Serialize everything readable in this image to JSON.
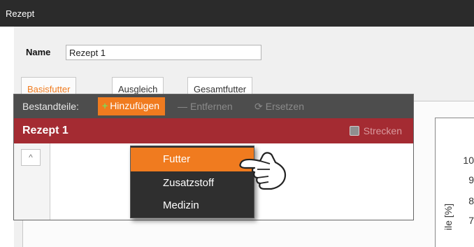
{
  "window": {
    "title": "Rezept"
  },
  "form": {
    "name_label": "Name",
    "name_value": "Rezept 1"
  },
  "tabs": [
    {
      "label": "Basisfutter",
      "active": true
    },
    {
      "label": "Ausgleich",
      "active": false
    },
    {
      "label": "Gesamtfutter",
      "active": false
    }
  ],
  "toolbar": {
    "label": "Bestandteile:",
    "add_icon": "+",
    "add_label": "Hinzufügen",
    "remove_icon": "—",
    "remove_label": "Entfernen",
    "replace_icon": "⟳",
    "replace_label": "Ersetzen"
  },
  "recipe": {
    "name": "Rezept 1",
    "stretch_label": "Strecken"
  },
  "dropdown": {
    "items": [
      {
        "label": "Futter",
        "active": true
      },
      {
        "label": "Zusatzstoff",
        "active": false
      },
      {
        "label": "Medizin",
        "active": false
      }
    ]
  },
  "chart": {
    "y_axis_label": "ile [%]",
    "ticks": [
      "10",
      "9",
      "8",
      "7"
    ]
  },
  "colors": {
    "accent": "#f07b1f",
    "titlebar": "#2b2b2b",
    "toolbar": "#4d4d4d",
    "recipe_header": "#a42b32",
    "dropdown_bg": "#2f2f2f",
    "plus_green": "#7ed957"
  }
}
